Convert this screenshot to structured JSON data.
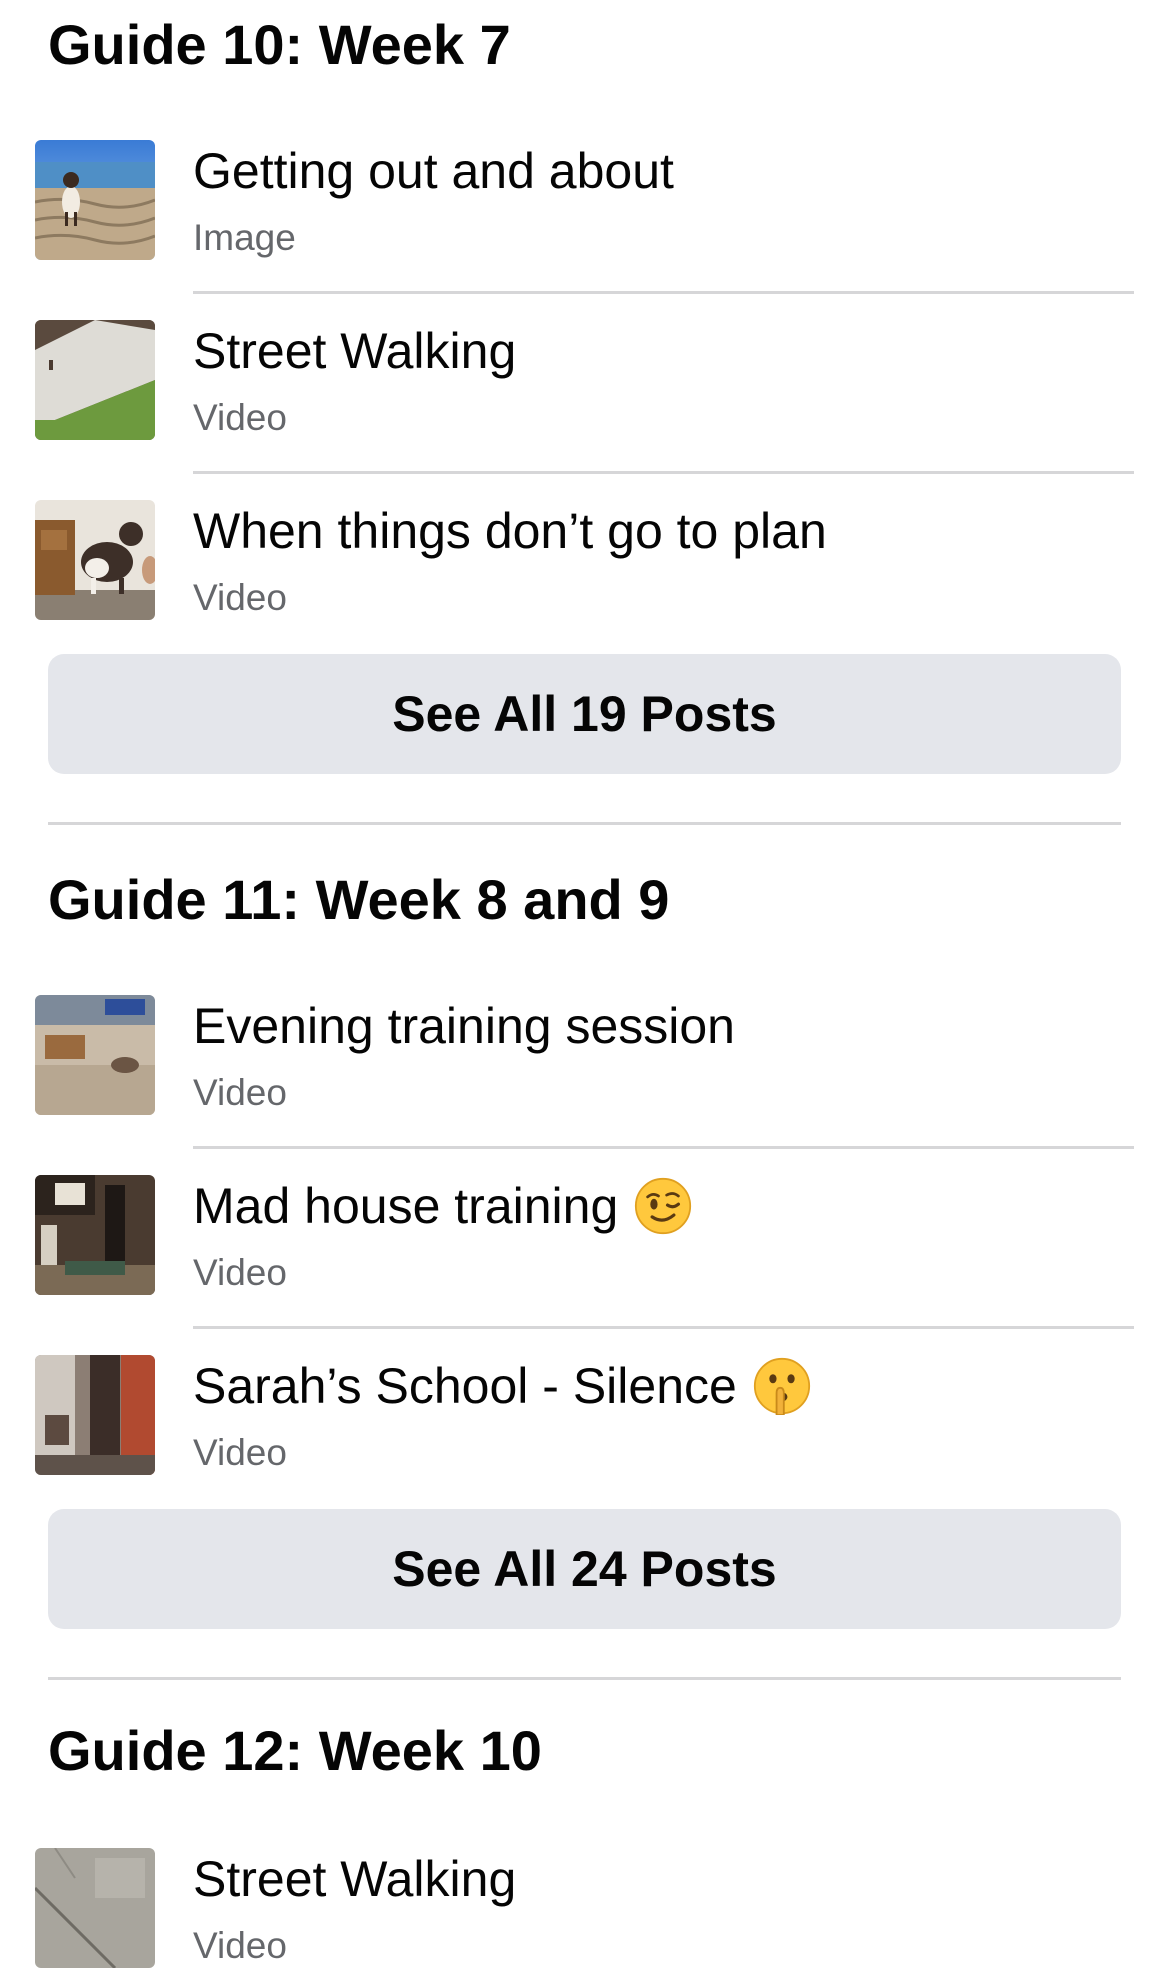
{
  "guides": [
    {
      "title": "Guide 10: Week 7",
      "posts": [
        {
          "title": "Getting out and about",
          "type": "Image",
          "thumbnail": "beach-dog-photo"
        },
        {
          "title": "Street Walking",
          "type": "Video",
          "thumbnail": "street-pavement-photo"
        },
        {
          "title": "When things don’t go to plan",
          "type": "Video",
          "thumbnail": "puppy-indoors-photo"
        }
      ],
      "see_all_label": "See All 19 Posts"
    },
    {
      "title": "Guide 11: Week 8 and 9",
      "posts": [
        {
          "title": "Evening training session",
          "type": "Video",
          "thumbnail": "living-room-photo"
        },
        {
          "title": "Mad house training",
          "type": "Video",
          "thumbnail": "house-training-photo",
          "emoji": "winking-face-emoji"
        },
        {
          "title": "Sarah’s School - Silence",
          "type": "Video",
          "thumbnail": "school-photo",
          "emoji": "shushing-face-emoji"
        }
      ],
      "see_all_label": "See All 24 Posts"
    },
    {
      "title": "Guide 12: Week 10",
      "posts": [
        {
          "title": "Street Walking",
          "type": "Video",
          "thumbnail": "pavement-photo"
        }
      ]
    }
  ],
  "colors": {
    "text_primary": "#050505",
    "text_secondary": "#65676b",
    "button_bg": "#e4e6eb",
    "divider": "#d6d6d8"
  }
}
